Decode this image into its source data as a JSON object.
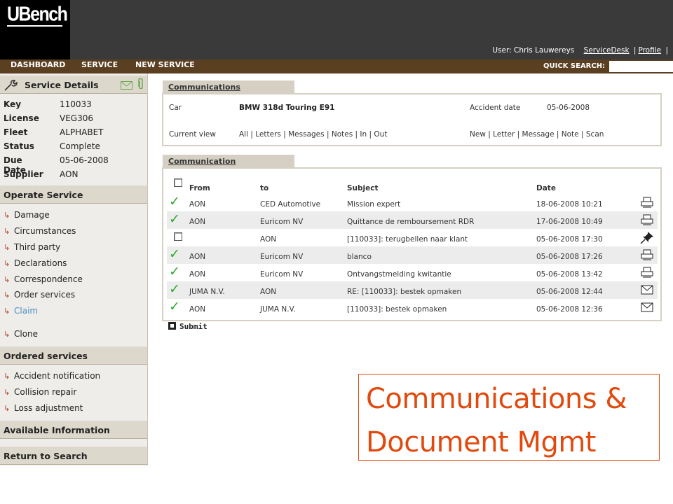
{
  "logo": {
    "text": "UBench"
  },
  "header": {
    "user_label": "User:",
    "user_name": "Chris Lauwereys",
    "links": [
      "ServiceDesk",
      "Profile"
    ],
    "separator": "|"
  },
  "nav": {
    "items": [
      "DASHBOARD",
      "SERVICE",
      "NEW SERVICE"
    ],
    "quick_search_label": "QUICK SEARCH:",
    "quick_search_value": ""
  },
  "sidebar": {
    "service_details": {
      "title": "Service Details",
      "fields": [
        {
          "key": "Key",
          "value": "110033"
        },
        {
          "key": "License",
          "value": "VEG306"
        },
        {
          "key": "Fleet",
          "value": "ALPHABET"
        },
        {
          "key": "Status",
          "value": "Complete"
        },
        {
          "key": "Due Date",
          "value": "05-06-2008"
        },
        {
          "key": "Supplier",
          "value": "AON"
        }
      ]
    },
    "operate_service": {
      "title": "Operate Service",
      "items": [
        "Damage",
        "Circumstances",
        "Third party",
        "Declarations",
        "Correspondence",
        "Order services",
        "Claim",
        "Clone"
      ],
      "active_item": "Claim",
      "arrow": "↳"
    },
    "ordered_services": {
      "title": "Ordered services",
      "items": [
        "Accident notification",
        "Collision repair",
        "Loss adjustment"
      ]
    },
    "available_information": {
      "title": "Available Information"
    },
    "return_to_search": {
      "title": "Return to Search"
    }
  },
  "communications": {
    "tab_label": "Communications",
    "car_label": "Car",
    "car_value": "BMW 318d Touring E91",
    "accident_label": "Accident date",
    "accident_value": "05-06-2008",
    "current_view_label": "Current view",
    "view_filters": [
      "All",
      "Letters",
      "Messages",
      "Notes",
      "In",
      "Out"
    ],
    "new_label": "New",
    "new_options": [
      "Letter",
      "Message",
      "Note",
      "Scan"
    ],
    "separator": "|"
  },
  "communication": {
    "tab_label": "Communication",
    "columns": [
      "From",
      "to",
      "Subject",
      "Date"
    ],
    "rows": [
      {
        "from": "AON",
        "to": "CED Automotive",
        "subject": "Mission expert",
        "date": "18-06-2008 10:21",
        "status": "checked",
        "icon": "printer-icon"
      },
      {
        "from": "AON",
        "to": "Euricom NV",
        "subject": "Quittance de remboursement RDR",
        "date": "17-06-2008 10:49",
        "status": "checked",
        "icon": "printer-icon"
      },
      {
        "from": "",
        "to": "AON",
        "subject": "[110033]: terugbellen naar klant",
        "date": "05-06-2008 17:30",
        "status": "unchecked",
        "icon": "pin-icon"
      },
      {
        "from": "AON",
        "to": "Euricom NV",
        "subject": "blanco",
        "date": "05-06-2008 17:26",
        "status": "checked",
        "icon": "printer-icon"
      },
      {
        "from": "AON",
        "to": "Euricom NV",
        "subject": "Ontvangstmelding kwitantie",
        "date": "05-06-2008 13:42",
        "status": "checked",
        "icon": "printer-icon"
      },
      {
        "from": "JUMA N.V.",
        "to": "AON",
        "subject": "RE: [110033]: bestek opmaken",
        "date": "05-06-2008 12:44",
        "status": "checked",
        "icon": "envelope-icon"
      },
      {
        "from": "AON",
        "to": "JUMA N.V.",
        "subject": "[110033]: bestek opmaken",
        "date": "05-06-2008 12:36",
        "status": "checked",
        "icon": "envelope-icon"
      }
    ],
    "check_glyph": "✓",
    "submit_label": "Submit"
  },
  "caption": {
    "line1": "Communications &",
    "line2": "Document Mgmt"
  },
  "colors": {
    "nav_brown": "#5a3f21",
    "header_dark": "#3a3a3a",
    "accent_orange": "#e04a0e",
    "check_green": "#2ea82e",
    "active_link_blue": "#4c8fc0"
  }
}
